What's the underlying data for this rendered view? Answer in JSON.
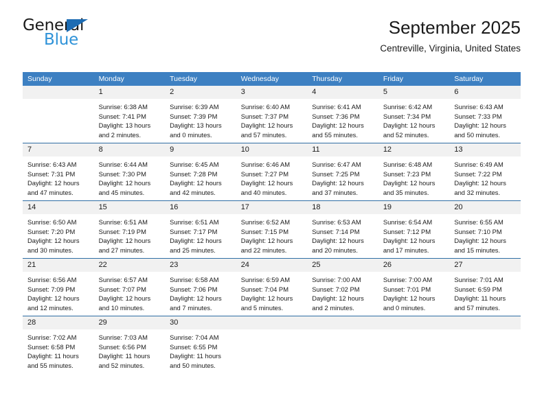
{
  "brand": {
    "name_part1": "General",
    "name_part2": "Blue",
    "accent_color": "#2e92d8",
    "triangle_color": "#1d6cb3"
  },
  "header": {
    "title": "September 2025",
    "subtitle": "Centreville, Virginia, United States"
  },
  "theme": {
    "header_bg": "#3d80c2",
    "header_text": "#ffffff",
    "daynum_bg": "#f1f1f1",
    "row_border": "#2e6da4"
  },
  "weekdays": [
    "Sunday",
    "Monday",
    "Tuesday",
    "Wednesday",
    "Thursday",
    "Friday",
    "Saturday"
  ],
  "labels": {
    "sunrise_prefix": "Sunrise:",
    "sunset_prefix": "Sunset:",
    "daylight_prefix": "Daylight:"
  },
  "weeks": [
    [
      {
        "day": "",
        "sunrise": "",
        "sunset": "",
        "daylight_line1": "",
        "daylight_line2": ""
      },
      {
        "day": "1",
        "sunrise": "Sunrise: 6:38 AM",
        "sunset": "Sunset: 7:41 PM",
        "daylight_line1": "Daylight: 13 hours",
        "daylight_line2": "and 2 minutes."
      },
      {
        "day": "2",
        "sunrise": "Sunrise: 6:39 AM",
        "sunset": "Sunset: 7:39 PM",
        "daylight_line1": "Daylight: 13 hours",
        "daylight_line2": "and 0 minutes."
      },
      {
        "day": "3",
        "sunrise": "Sunrise: 6:40 AM",
        "sunset": "Sunset: 7:37 PM",
        "daylight_line1": "Daylight: 12 hours",
        "daylight_line2": "and 57 minutes."
      },
      {
        "day": "4",
        "sunrise": "Sunrise: 6:41 AM",
        "sunset": "Sunset: 7:36 PM",
        "daylight_line1": "Daylight: 12 hours",
        "daylight_line2": "and 55 minutes."
      },
      {
        "day": "5",
        "sunrise": "Sunrise: 6:42 AM",
        "sunset": "Sunset: 7:34 PM",
        "daylight_line1": "Daylight: 12 hours",
        "daylight_line2": "and 52 minutes."
      },
      {
        "day": "6",
        "sunrise": "Sunrise: 6:43 AM",
        "sunset": "Sunset: 7:33 PM",
        "daylight_line1": "Daylight: 12 hours",
        "daylight_line2": "and 50 minutes."
      }
    ],
    [
      {
        "day": "7",
        "sunrise": "Sunrise: 6:43 AM",
        "sunset": "Sunset: 7:31 PM",
        "daylight_line1": "Daylight: 12 hours",
        "daylight_line2": "and 47 minutes."
      },
      {
        "day": "8",
        "sunrise": "Sunrise: 6:44 AM",
        "sunset": "Sunset: 7:30 PM",
        "daylight_line1": "Daylight: 12 hours",
        "daylight_line2": "and 45 minutes."
      },
      {
        "day": "9",
        "sunrise": "Sunrise: 6:45 AM",
        "sunset": "Sunset: 7:28 PM",
        "daylight_line1": "Daylight: 12 hours",
        "daylight_line2": "and 42 minutes."
      },
      {
        "day": "10",
        "sunrise": "Sunrise: 6:46 AM",
        "sunset": "Sunset: 7:27 PM",
        "daylight_line1": "Daylight: 12 hours",
        "daylight_line2": "and 40 minutes."
      },
      {
        "day": "11",
        "sunrise": "Sunrise: 6:47 AM",
        "sunset": "Sunset: 7:25 PM",
        "daylight_line1": "Daylight: 12 hours",
        "daylight_line2": "and 37 minutes."
      },
      {
        "day": "12",
        "sunrise": "Sunrise: 6:48 AM",
        "sunset": "Sunset: 7:23 PM",
        "daylight_line1": "Daylight: 12 hours",
        "daylight_line2": "and 35 minutes."
      },
      {
        "day": "13",
        "sunrise": "Sunrise: 6:49 AM",
        "sunset": "Sunset: 7:22 PM",
        "daylight_line1": "Daylight: 12 hours",
        "daylight_line2": "and 32 minutes."
      }
    ],
    [
      {
        "day": "14",
        "sunrise": "Sunrise: 6:50 AM",
        "sunset": "Sunset: 7:20 PM",
        "daylight_line1": "Daylight: 12 hours",
        "daylight_line2": "and 30 minutes."
      },
      {
        "day": "15",
        "sunrise": "Sunrise: 6:51 AM",
        "sunset": "Sunset: 7:19 PM",
        "daylight_line1": "Daylight: 12 hours",
        "daylight_line2": "and 27 minutes."
      },
      {
        "day": "16",
        "sunrise": "Sunrise: 6:51 AM",
        "sunset": "Sunset: 7:17 PM",
        "daylight_line1": "Daylight: 12 hours",
        "daylight_line2": "and 25 minutes."
      },
      {
        "day": "17",
        "sunrise": "Sunrise: 6:52 AM",
        "sunset": "Sunset: 7:15 PM",
        "daylight_line1": "Daylight: 12 hours",
        "daylight_line2": "and 22 minutes."
      },
      {
        "day": "18",
        "sunrise": "Sunrise: 6:53 AM",
        "sunset": "Sunset: 7:14 PM",
        "daylight_line1": "Daylight: 12 hours",
        "daylight_line2": "and 20 minutes."
      },
      {
        "day": "19",
        "sunrise": "Sunrise: 6:54 AM",
        "sunset": "Sunset: 7:12 PM",
        "daylight_line1": "Daylight: 12 hours",
        "daylight_line2": "and 17 minutes."
      },
      {
        "day": "20",
        "sunrise": "Sunrise: 6:55 AM",
        "sunset": "Sunset: 7:10 PM",
        "daylight_line1": "Daylight: 12 hours",
        "daylight_line2": "and 15 minutes."
      }
    ],
    [
      {
        "day": "21",
        "sunrise": "Sunrise: 6:56 AM",
        "sunset": "Sunset: 7:09 PM",
        "daylight_line1": "Daylight: 12 hours",
        "daylight_line2": "and 12 minutes."
      },
      {
        "day": "22",
        "sunrise": "Sunrise: 6:57 AM",
        "sunset": "Sunset: 7:07 PM",
        "daylight_line1": "Daylight: 12 hours",
        "daylight_line2": "and 10 minutes."
      },
      {
        "day": "23",
        "sunrise": "Sunrise: 6:58 AM",
        "sunset": "Sunset: 7:06 PM",
        "daylight_line1": "Daylight: 12 hours",
        "daylight_line2": "and 7 minutes."
      },
      {
        "day": "24",
        "sunrise": "Sunrise: 6:59 AM",
        "sunset": "Sunset: 7:04 PM",
        "daylight_line1": "Daylight: 12 hours",
        "daylight_line2": "and 5 minutes."
      },
      {
        "day": "25",
        "sunrise": "Sunrise: 7:00 AM",
        "sunset": "Sunset: 7:02 PM",
        "daylight_line1": "Daylight: 12 hours",
        "daylight_line2": "and 2 minutes."
      },
      {
        "day": "26",
        "sunrise": "Sunrise: 7:00 AM",
        "sunset": "Sunset: 7:01 PM",
        "daylight_line1": "Daylight: 12 hours",
        "daylight_line2": "and 0 minutes."
      },
      {
        "day": "27",
        "sunrise": "Sunrise: 7:01 AM",
        "sunset": "Sunset: 6:59 PM",
        "daylight_line1": "Daylight: 11 hours",
        "daylight_line2": "and 57 minutes."
      }
    ],
    [
      {
        "day": "28",
        "sunrise": "Sunrise: 7:02 AM",
        "sunset": "Sunset: 6:58 PM",
        "daylight_line1": "Daylight: 11 hours",
        "daylight_line2": "and 55 minutes."
      },
      {
        "day": "29",
        "sunrise": "Sunrise: 7:03 AM",
        "sunset": "Sunset: 6:56 PM",
        "daylight_line1": "Daylight: 11 hours",
        "daylight_line2": "and 52 minutes."
      },
      {
        "day": "30",
        "sunrise": "Sunrise: 7:04 AM",
        "sunset": "Sunset: 6:55 PM",
        "daylight_line1": "Daylight: 11 hours",
        "daylight_line2": "and 50 minutes."
      },
      {
        "day": "",
        "sunrise": "",
        "sunset": "",
        "daylight_line1": "",
        "daylight_line2": ""
      },
      {
        "day": "",
        "sunrise": "",
        "sunset": "",
        "daylight_line1": "",
        "daylight_line2": ""
      },
      {
        "day": "",
        "sunrise": "",
        "sunset": "",
        "daylight_line1": "",
        "daylight_line2": ""
      },
      {
        "day": "",
        "sunrise": "",
        "sunset": "",
        "daylight_line1": "",
        "daylight_line2": ""
      }
    ]
  ]
}
